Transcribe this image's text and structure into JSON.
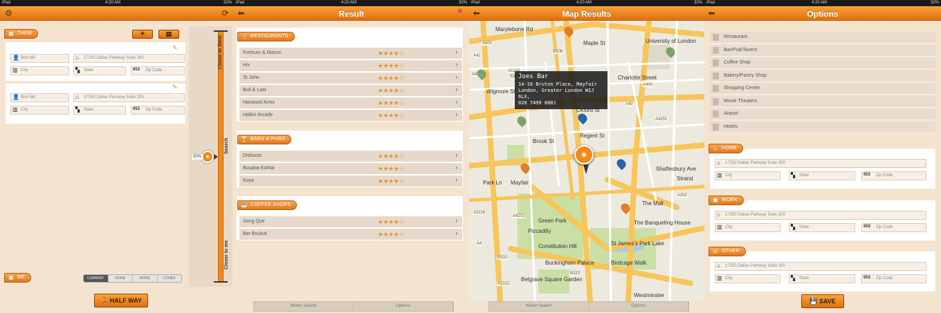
{
  "statusbar": {
    "carrier": "iPad",
    "time": "4:20 AM",
    "battery": "32%"
  },
  "screen1": {
    "them_label": "THEM",
    "add_icon": "+",
    "list_icon": "▤",
    "entries": [
      {
        "name": "Bob Nill",
        "address": "17250 Dallas Parkway Suite 200",
        "city": "City",
        "state": "State",
        "zip_prefix": "653",
        "zip": "Zip Code"
      },
      {
        "name": "Bob Nill",
        "address": "17250 Dallas Parkway Suite 200",
        "city": "City",
        "state": "State",
        "zip_prefix": "653",
        "zip": "Zip Code"
      }
    ],
    "slider": {
      "top_label": "Closer to them",
      "middle_label": "Search",
      "bottom_label": "Closer to me",
      "percent_text": "50%",
      "value": 0.5
    },
    "me_label": "ME",
    "segments": [
      "CURRENT",
      "HOME",
      "WORK",
      "OTHER"
    ],
    "halfway_button": "HALF WAY"
  },
  "screen2": {
    "title": "Result",
    "sections": [
      {
        "label": "RESTAURANTS",
        "items": [
          {
            "name": "Fortnum & Mason",
            "stars": 4
          },
          {
            "name": "Hix",
            "stars": 4
          },
          {
            "name": "St John",
            "stars": 4
          },
          {
            "name": "Bull & Last",
            "stars": 4
          },
          {
            "name": "Harwood Arms",
            "stars": 4
          },
          {
            "name": "Halkin Arcade",
            "stars": 4
          }
        ]
      },
      {
        "label": "BARS & PUBS",
        "items": [
          {
            "name": "Dishoom",
            "stars": 4
          },
          {
            "name": "Busaba Eathai",
            "stars": 4
          },
          {
            "name": "Koya",
            "stars": 4
          }
        ]
      },
      {
        "label": "COFFEE SHOPS",
        "items": [
          {
            "name": "Song Que",
            "stars": 4
          },
          {
            "name": "Bar Boulud",
            "stars": 4
          }
        ]
      }
    ],
    "bottom": [
      "Widen Search",
      "Options"
    ]
  },
  "screen3": {
    "title": "Map Results",
    "popup": {
      "name": "Joes Bar",
      "line1": "14-16 Bruton Place, Mayfair",
      "line2": "London, Greater London W1J 6LX,",
      "phone": "020 7499 8881"
    },
    "labels": [
      "Marylebone Rd",
      "A41",
      "A501",
      "A5204",
      "B506",
      "Maple St",
      "University of London",
      "Charlotte Street",
      "A400",
      "A4201",
      "A40",
      "Wigmore St",
      "Oxford St",
      "Brook St",
      "Mayfair",
      "Green Park",
      "Constitution Hill",
      "Buckingham Palace",
      "Belgrave Square Garden",
      "Westminster",
      "St James's Park Lake",
      "The Banqueting House",
      "Birdcage Walk",
      "The Mall",
      "Strand",
      "Shaftesbury Ave",
      "A4",
      "A302",
      "Park Ln",
      "Piccadilly",
      "B323",
      "A3212",
      "A4202",
      "B324",
      "B310",
      "A3216",
      "A4211",
      "Regent St"
    ],
    "bottom": [
      "Widen Search",
      "Options"
    ]
  },
  "screen4": {
    "title": "Options",
    "categories": [
      "Restaurant",
      "Bar/Pub/Tavern",
      "Coffee Shop",
      "Bakery/Pastry Shop",
      "Shopping Center",
      "Movie Theaters",
      "Airport",
      "Hotels"
    ],
    "groups": [
      {
        "label": "HOME",
        "address": "17250 Dallas Parkway Suite 200",
        "city": "City",
        "state": "State",
        "zip_prefix": "653",
        "zip": "Zip Code"
      },
      {
        "label": "WORK",
        "address": "17250 Dallas Parkway Suite 200",
        "city": "City",
        "state": "State",
        "zip_prefix": "653",
        "zip": "Zip Code"
      },
      {
        "label": "OTHER",
        "address": "17250 Dallas Parkway Suite 200",
        "city": "City",
        "state": "State",
        "zip_prefix": "653",
        "zip": "Zip Code"
      }
    ],
    "save_button": "SAVE"
  },
  "colors": {
    "accent": "#f08a1c",
    "accent_dark": "#c25f0a",
    "background": "#f4e3cf"
  }
}
